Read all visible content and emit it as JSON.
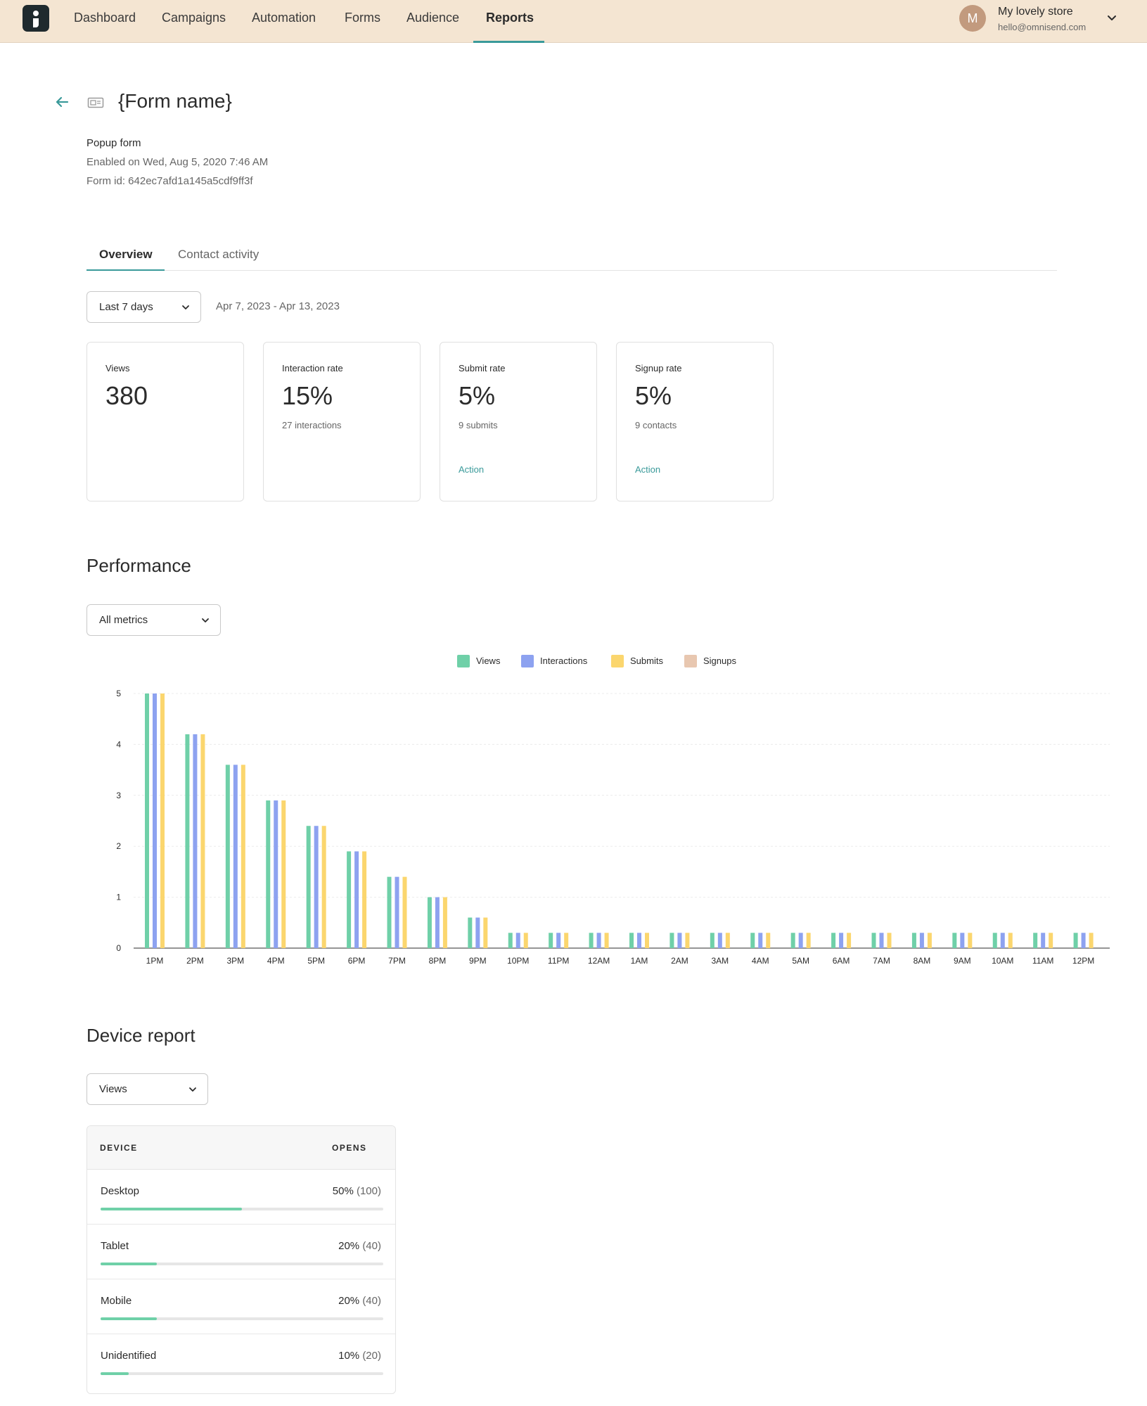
{
  "nav": {
    "items": [
      {
        "label": "Dashboard",
        "active": false
      },
      {
        "label": "Campaigns",
        "active": false
      },
      {
        "label": "Automation",
        "active": false
      },
      {
        "label": "Forms",
        "active": false
      },
      {
        "label": "Audience",
        "active": false
      },
      {
        "label": "Reports",
        "active": true
      }
    ],
    "account": {
      "avatar_initial": "M",
      "store_name": "My lovely store",
      "email": "hello@omnisend.com"
    }
  },
  "header": {
    "title": "{Form name}",
    "form_type": "Popup form",
    "enabled_on": "Enabled on Wed, Aug 5, 2020 7:46 AM",
    "form_id": "Form id: 642ec7afd1a145a5cdf9ff3f"
  },
  "tabs": [
    {
      "label": "Overview",
      "active": true
    },
    {
      "label": "Contact activity",
      "active": false
    }
  ],
  "filters": {
    "period": "Last 7 days",
    "date_range": "Apr 7, 2023 - Apr 13, 2023"
  },
  "stats": [
    {
      "label": "Views",
      "value": "380",
      "sub": "",
      "action": ""
    },
    {
      "label": "Interaction rate",
      "value": "15%",
      "sub": "27 interactions",
      "action": ""
    },
    {
      "label": "Submit rate",
      "value": "5%",
      "sub": "9 submits",
      "action": "Action"
    },
    {
      "label": "Signup rate",
      "value": "5%",
      "sub": "9 contacts",
      "action": "Action"
    }
  ],
  "performance": {
    "title": "Performance",
    "metric_select": "All metrics"
  },
  "chart_data": {
    "type": "bar",
    "categories": [
      "1PM",
      "2PM",
      "3PM",
      "4PM",
      "5PM",
      "6PM",
      "7PM",
      "8PM",
      "9PM",
      "10PM",
      "11PM",
      "12AM",
      "1AM",
      "2AM",
      "3AM",
      "4AM",
      "5AM",
      "6AM",
      "7AM",
      "8AM",
      "9AM",
      "10AM",
      "11AM",
      "12PM"
    ],
    "series": [
      {
        "name": "Views",
        "color": "#6fd0a8",
        "values": [
          5,
          4.2,
          3.6,
          2.9,
          2.4,
          1.9,
          1.4,
          1.0,
          0.6,
          0.3,
          0.3,
          0.3,
          0.3,
          0.3,
          0.3,
          0.3,
          0.3,
          0.3,
          0.3,
          0.3,
          0.3,
          0.3,
          0.3,
          0.3
        ]
      },
      {
        "name": "Interactions",
        "color": "#8da2f0",
        "values": [
          5,
          4.2,
          3.6,
          2.9,
          2.4,
          1.9,
          1.4,
          1.0,
          0.6,
          0.3,
          0.3,
          0.3,
          0.3,
          0.3,
          0.3,
          0.3,
          0.3,
          0.3,
          0.3,
          0.3,
          0.3,
          0.3,
          0.3,
          0.3
        ]
      },
      {
        "name": "Submits",
        "color": "#fbd66e",
        "values": [
          5,
          4.2,
          3.6,
          2.9,
          2.4,
          1.9,
          1.4,
          1.0,
          0.6,
          0.3,
          0.3,
          0.3,
          0.3,
          0.3,
          0.3,
          0.3,
          0.3,
          0.3,
          0.3,
          0.3,
          0.3,
          0.3,
          0.3,
          0.3
        ]
      },
      {
        "name": "Signups",
        "color": "#e8c7b0",
        "values": [
          0,
          0,
          0,
          0,
          0,
          0,
          0,
          0,
          0,
          0,
          0,
          0,
          0,
          0,
          0,
          0,
          0,
          0,
          0,
          0,
          0,
          0,
          0,
          0
        ]
      }
    ],
    "yticks": [
      "0",
      "1",
      "2",
      "3",
      "4",
      "5"
    ],
    "ylim": [
      0,
      5
    ],
    "grid": true,
    "legend": "top-center"
  },
  "device_report": {
    "title": "Device report",
    "metric_select": "Views",
    "columns": [
      "DEVICE",
      "OPENS"
    ],
    "rows": [
      {
        "device": "Desktop",
        "percent": "50%",
        "count": "(100)",
        "share": 0.5
      },
      {
        "device": "Tablet",
        "percent": "20%",
        "count": "(40)",
        "share": 0.2
      },
      {
        "device": "Mobile",
        "percent": "20%",
        "count": "(40)",
        "share": 0.2
      },
      {
        "device": "Unidentified",
        "percent": "10%",
        "count": "(20)",
        "share": 0.1
      }
    ]
  }
}
